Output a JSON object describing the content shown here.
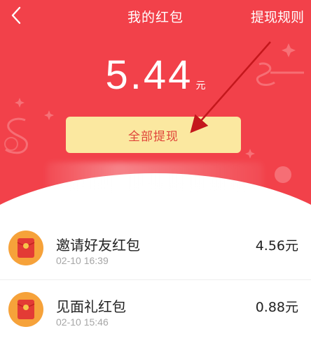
{
  "navbar": {
    "back_icon": "chevron-left-icon",
    "title": "我的红包",
    "rules_link": "提现规则"
  },
  "balance": {
    "amount": "5.44",
    "unit": "元"
  },
  "withdraw_button": "全部提现",
  "colors": {
    "header_red": "#f2414a",
    "button_yellow": "#fbe8a0",
    "button_text": "#e0453a",
    "icon_orange": "#f6a23a",
    "annotation_arrow": "#c4171c"
  },
  "records": [
    {
      "title": "邀请好友红包",
      "time": "02-10 16:39",
      "amount": "4.56元",
      "icon": "red-envelope-icon"
    },
    {
      "title": "见面礼红包",
      "time": "02-10 15:46",
      "amount": "0.88元",
      "icon": "red-envelope-icon"
    }
  ]
}
